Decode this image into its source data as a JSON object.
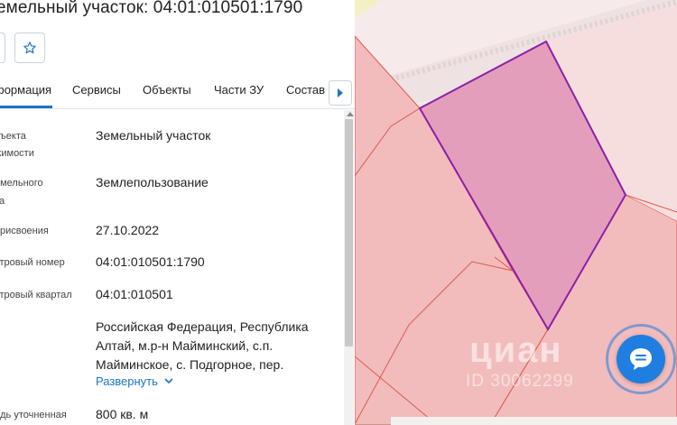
{
  "header": {
    "title": "емельный участок: 04:01:010501:1790"
  },
  "actions": {
    "favorite_icon": "star-icon"
  },
  "tabs": [
    {
      "label": "формация",
      "active": true
    },
    {
      "label": "Сервисы"
    },
    {
      "label": "Объекты"
    },
    {
      "label": "Части ЗУ"
    },
    {
      "label": "Состав"
    }
  ],
  "tabs_next_icon": "chevron-right-icon",
  "details": [
    {
      "label_lines": [
        "бъекта",
        "жимости"
      ],
      "value": "Земельный участок"
    },
    {
      "label_lines": [
        "емельного",
        "ка"
      ],
      "value": "Землепользование"
    },
    {
      "label_lines": [
        "присвоения"
      ],
      "value": "27.10.2022"
    },
    {
      "label_lines": [
        "стровый номер"
      ],
      "value": "04:01:010501:1790"
    },
    {
      "label_lines": [
        "стровый квартал"
      ],
      "value": "04:01:010501"
    },
    {
      "label_lines": [
        "с"
      ],
      "value_lines": [
        "Российская Федерация, Республика",
        "Алтай, м.р-н Майминский, с.п.",
        "Майминское, с. Подгорное, пер."
      ]
    },
    {
      "label_lines": [
        "адь уточненная"
      ],
      "value": "800 кв. м"
    }
  ],
  "expand_label": "Развернуть",
  "map": {
    "colors": {
      "parcel_fill": "#f2bcbc",
      "parcel_border": "#e0584c",
      "selected_fill": "#e39ebc",
      "selected_border": "#8e1fa8",
      "road": "#f7eaea"
    },
    "watermark": "циан",
    "watermark_id": "ID 30062299"
  },
  "chat_icon": "chat-bubble-icon"
}
